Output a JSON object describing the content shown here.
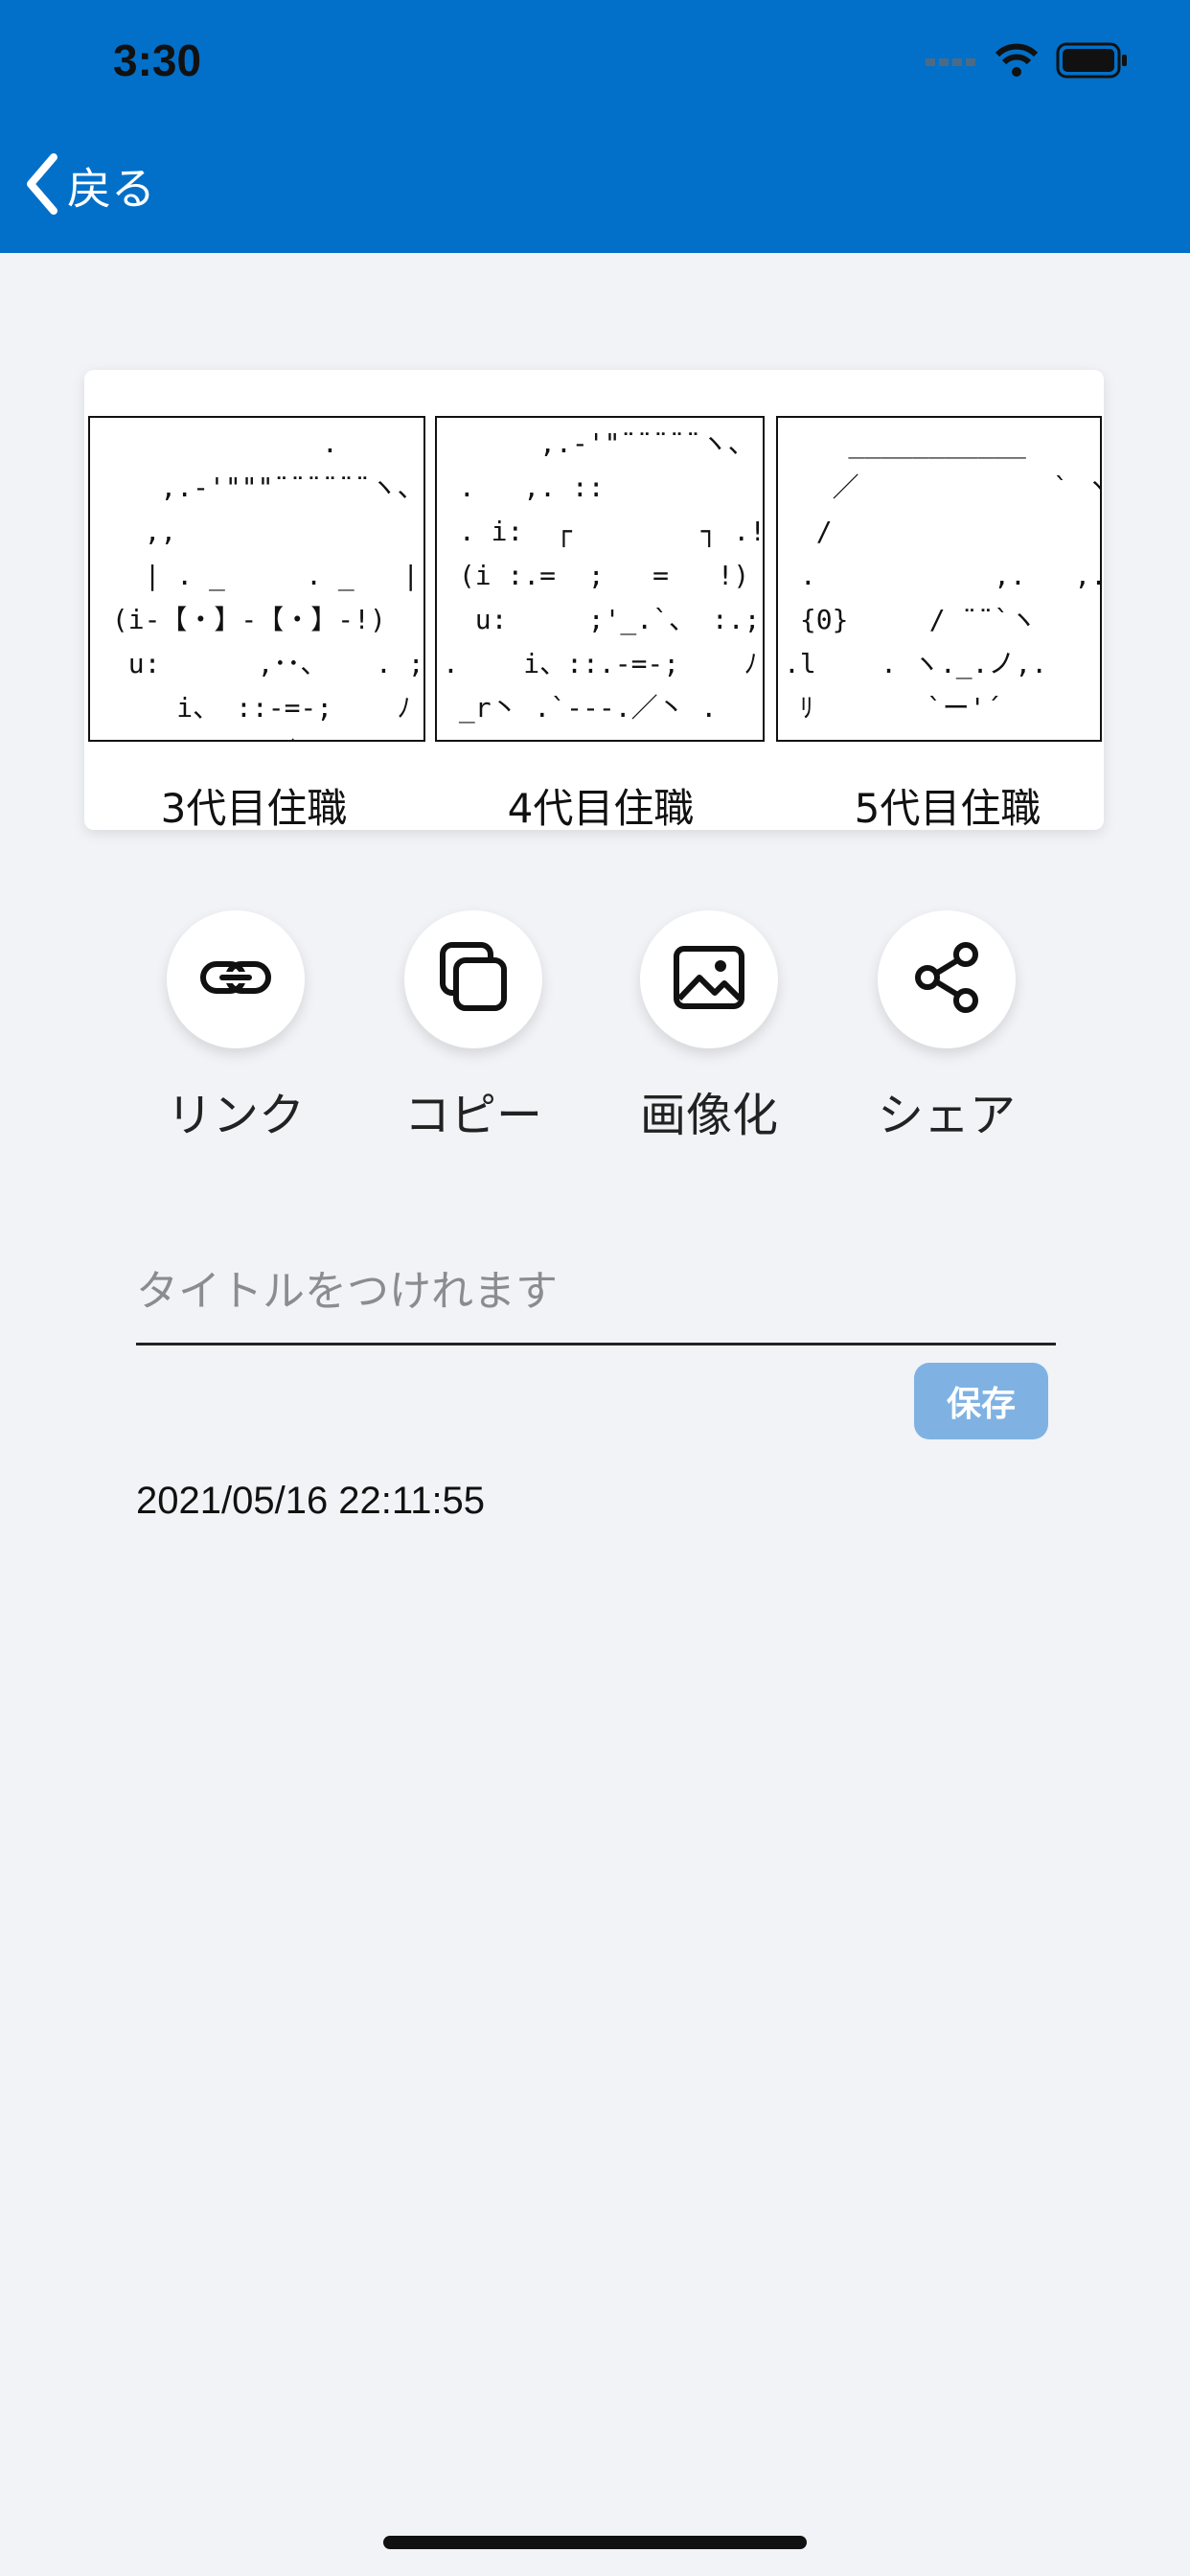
{
  "status_bar": {
    "time": "3:30",
    "icons": [
      "cellular-dots-icon",
      "wifi-icon",
      "battery-icon"
    ]
  },
  "nav": {
    "back_label": "戻る",
    "back_icon": "chevron-left-icon",
    "bar_color": "#0270c9"
  },
  "aa_cards": [
    {
      "art": "              .\n    ,.‐'\"\"\"¨¨¨¨¨¨ヽ、\n   ,,\n   | . _     . _   |\n (i‐【・】‐【・】‐!)\n  u:      ,･･、   . ;u\n     i、 ::-=-;    ﾉ\n  _r丶`.---／丶、",
      "caption": "3代目住職"
    },
    {
      "art": "      ,.‐'\"¨¨¨¨¨ヽ、\n .   ,. ::          ヽ,.\n . i:  ┌        ┐ .!\n (i :.=  ;   =   !)\n  u:     ;'_.`、 :.;u .\n.    i、::.-=-;    ﾉ .\n _r丶 .`---.／丶 .",
      "caption": "4代目住職"
    },
    {
      "art": "    ___________\n   ／            ` ヽ、\n  /                   ,\n .           ,.   ,.\n {0}     / ¨¨`ヽ    {0}.\n.l    . ヽ._.ノ,.     ,\n ﾘ       `ー'´        ,\n                      ,",
      "caption": "5代目住職"
    }
  ],
  "actions": [
    {
      "label": "リンク",
      "icon": "link-icon"
    },
    {
      "label": "コピー",
      "icon": "copy-icon"
    },
    {
      "label": "画像化",
      "icon": "image-icon"
    },
    {
      "label": "シェア",
      "icon": "share-icon"
    }
  ],
  "title_field": {
    "placeholder": "タイトルをつけれます",
    "value": ""
  },
  "save_button": {
    "label": "保存"
  },
  "timestamp": "2021/05/16 22:11:55"
}
